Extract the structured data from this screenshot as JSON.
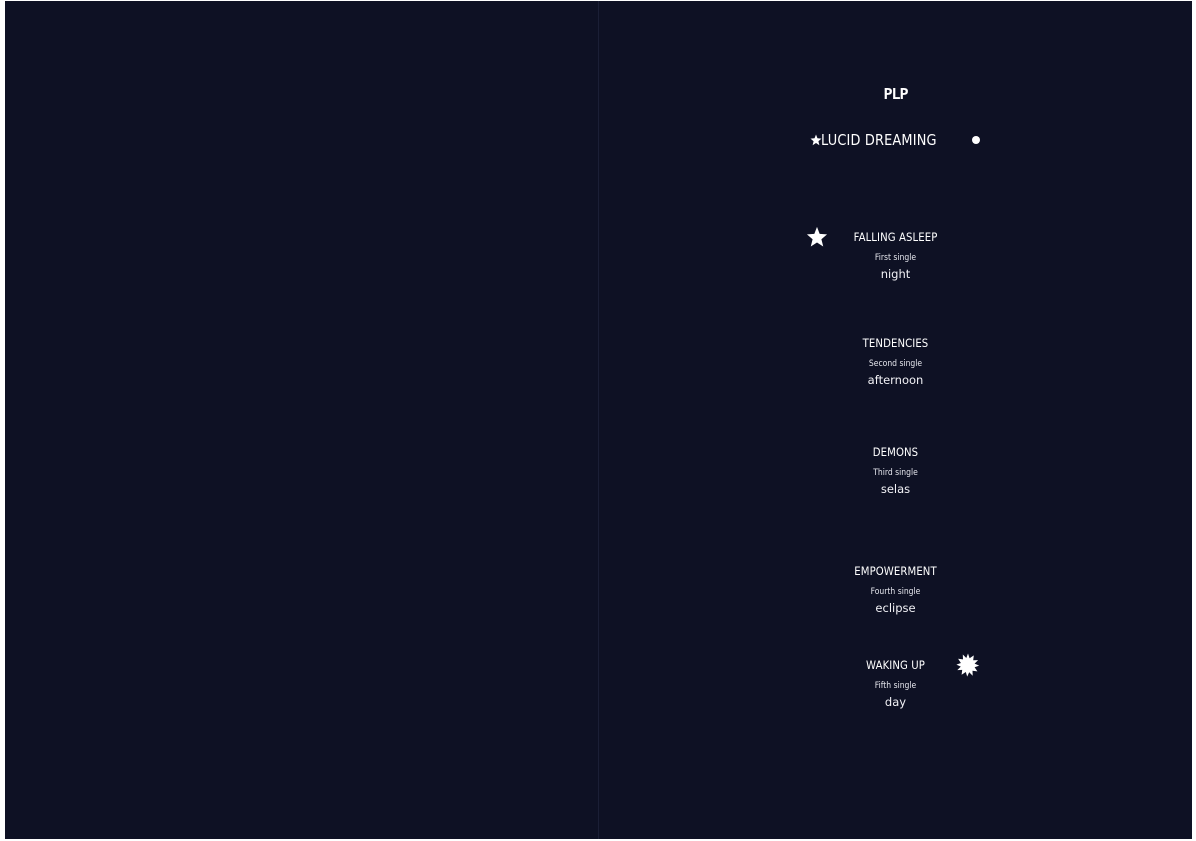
{
  "logo": "PLP",
  "album": {
    "title": "LUCID DREAMING"
  },
  "tracks": [
    {
      "name": "FALLING ASLEEP",
      "single": "First single",
      "when": "night"
    },
    {
      "name": "TENDENCIES",
      "single": "Second single",
      "when": "afternoon"
    },
    {
      "name": "DEMONS",
      "single": "Third single",
      "when": "selas"
    },
    {
      "name": "EMPOWERMENT",
      "single": "Fourth single",
      "when": "eclipse"
    },
    {
      "name": "WAKING UP",
      "single": "Fifth single",
      "when": "day"
    }
  ],
  "icons": {
    "title_left": "star-icon",
    "title_right": "dot-icon",
    "first_track": "star-icon",
    "last_track": "sun-icon"
  },
  "colors": {
    "background": "#0e1124",
    "text": "#ffffff"
  }
}
